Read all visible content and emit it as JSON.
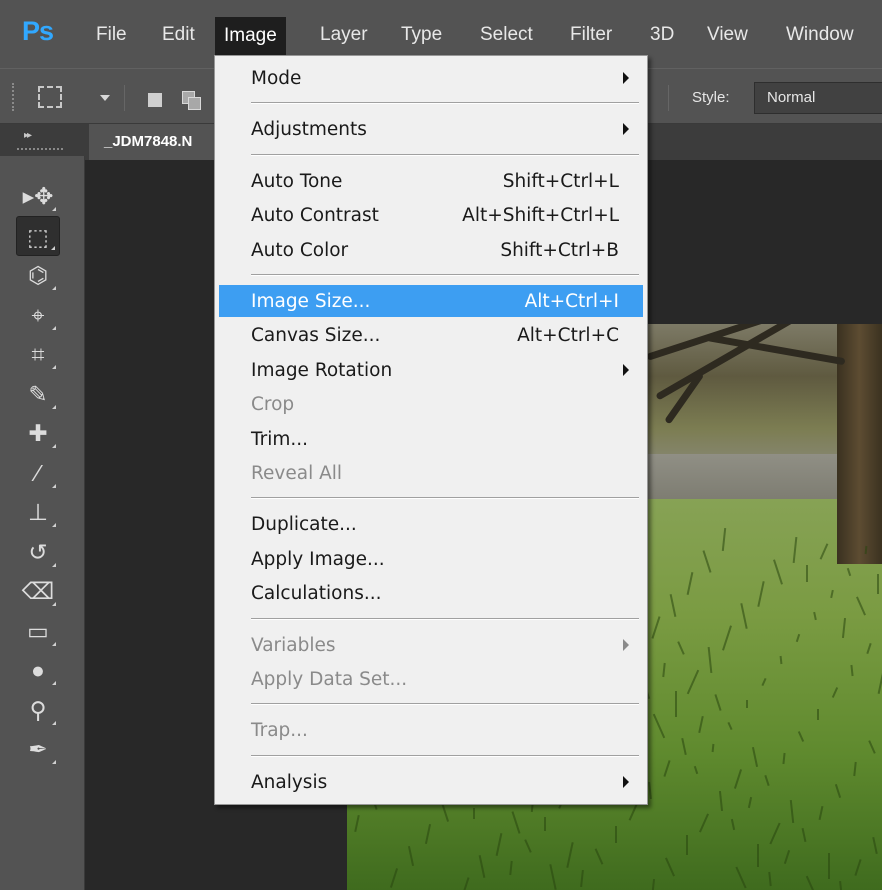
{
  "app": {
    "logo": "Ps",
    "menubar": [
      "File",
      "Edit",
      "Image",
      "Layer",
      "Type",
      "Select",
      "Filter",
      "3D",
      "View",
      "Window"
    ],
    "active_menu": "Image"
  },
  "options_bar": {
    "style_label": "Style:",
    "style_value": "Normal"
  },
  "document": {
    "tab_label": "_JDM7848.N"
  },
  "tools": [
    {
      "name": "move-tool-icon",
      "glyph": "▸✥"
    },
    {
      "name": "rectangular-marquee-tool-icon",
      "glyph": "⬚",
      "selected": true
    },
    {
      "name": "lasso-tool-icon",
      "glyph": "⌬"
    },
    {
      "name": "quick-selection-tool-icon",
      "glyph": "⌖"
    },
    {
      "name": "crop-tool-icon",
      "glyph": "⌗"
    },
    {
      "name": "eyedropper-tool-icon",
      "glyph": "✎"
    },
    {
      "name": "healing-brush-tool-icon",
      "glyph": "✚"
    },
    {
      "name": "brush-tool-icon",
      "glyph": "⁄"
    },
    {
      "name": "clone-stamp-tool-icon",
      "glyph": "⊥"
    },
    {
      "name": "history-brush-tool-icon",
      "glyph": "↺"
    },
    {
      "name": "eraser-tool-icon",
      "glyph": "⌫"
    },
    {
      "name": "gradient-tool-icon",
      "glyph": "▭"
    },
    {
      "name": "blur-tool-icon",
      "glyph": "●"
    },
    {
      "name": "dodge-tool-icon",
      "glyph": "⚲"
    },
    {
      "name": "pen-tool-icon",
      "glyph": "✒"
    }
  ],
  "image_menu": {
    "items": [
      {
        "label": "Mode",
        "submenu": true
      },
      {
        "separator": true
      },
      {
        "label": "Adjustments",
        "submenu": true
      },
      {
        "separator": true
      },
      {
        "label": "Auto Tone",
        "shortcut": "Shift+Ctrl+L"
      },
      {
        "label": "Auto Contrast",
        "shortcut": "Alt+Shift+Ctrl+L"
      },
      {
        "label": "Auto Color",
        "shortcut": "Shift+Ctrl+B"
      },
      {
        "separator": true
      },
      {
        "label": "Image Size...",
        "shortcut": "Alt+Ctrl+I",
        "highlighted": true
      },
      {
        "label": "Canvas Size...",
        "shortcut": "Alt+Ctrl+C"
      },
      {
        "label": "Image Rotation",
        "submenu": true
      },
      {
        "label": "Crop",
        "disabled": true
      },
      {
        "label": "Trim..."
      },
      {
        "label": "Reveal All",
        "disabled": true
      },
      {
        "separator": true
      },
      {
        "label": "Duplicate..."
      },
      {
        "label": "Apply Image..."
      },
      {
        "label": "Calculations..."
      },
      {
        "separator": true
      },
      {
        "label": "Variables",
        "submenu": true,
        "disabled": true
      },
      {
        "label": "Apply Data Set...",
        "disabled": true
      },
      {
        "separator": true
      },
      {
        "label": "Trap...",
        "disabled": true
      },
      {
        "separator": true
      },
      {
        "label": "Analysis",
        "submenu": true
      }
    ]
  },
  "colors": {
    "ps_blue": "#31a8ff",
    "menu_highlight": "#3d9ef2",
    "panel_gray": "#535353",
    "canvas_dark": "#282828"
  }
}
